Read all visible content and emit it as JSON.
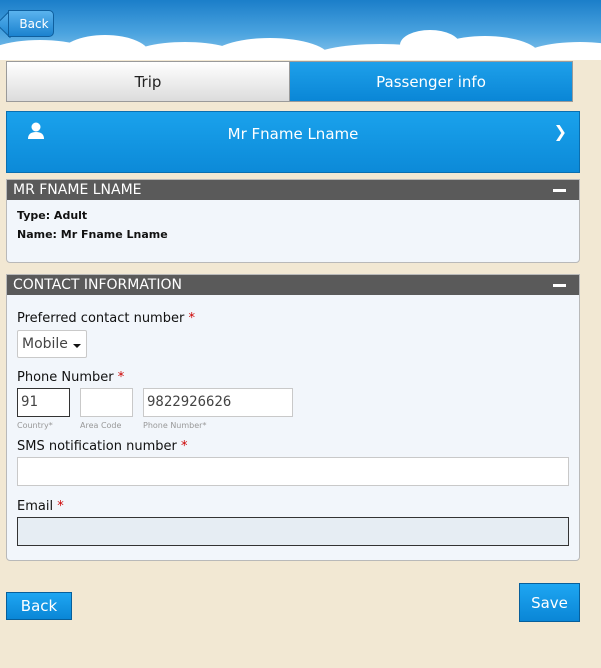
{
  "header": {
    "back_label": "Back"
  },
  "tabs": [
    {
      "label": "Trip"
    },
    {
      "label": "Passenger info"
    }
  ],
  "passenger_bar": {
    "name": "Mr Fname Lname",
    "icon": "user-icon",
    "chevron": "chevron-right-icon"
  },
  "passenger_panel": {
    "title": "MR FNAME LNAME",
    "type_line": "Type: Adult",
    "name_line": "Name: Mr Fname Lname"
  },
  "contact_panel": {
    "title": "CONTACT INFORMATION",
    "preferred_label": "Preferred contact number",
    "preferred_value": "Mobile",
    "phone_label": "Phone Number",
    "country_value": "91",
    "area_value": "",
    "phone_value": "9822926626",
    "country_caption": "Country",
    "area_caption": "Area Code",
    "phone_caption": "Phone Number",
    "sms_label": "SMS notification number",
    "sms_value": "",
    "email_label": "Email",
    "email_value": "",
    "required_mark": "*"
  },
  "footer": {
    "back_label": "Back",
    "save_label": "Save"
  },
  "colors": {
    "accent": "#0a86d6",
    "panel_header": "#5a5a5a",
    "background": "#f2e8d3"
  }
}
